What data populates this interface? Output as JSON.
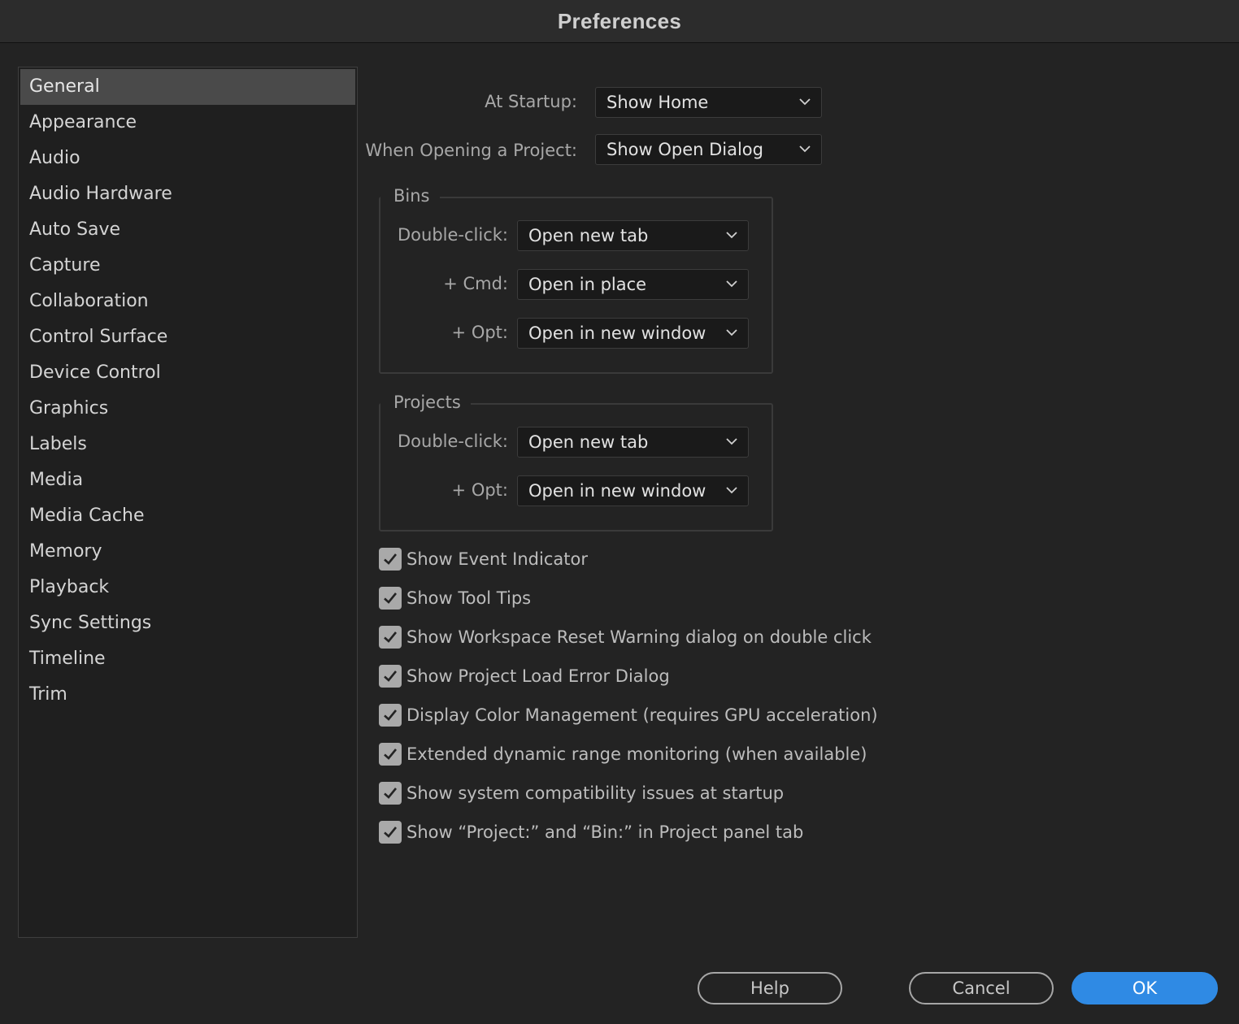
{
  "window": {
    "title": "Preferences"
  },
  "sidebar": {
    "items": [
      {
        "label": "General",
        "selected": true
      },
      {
        "label": "Appearance"
      },
      {
        "label": "Audio"
      },
      {
        "label": "Audio Hardware"
      },
      {
        "label": "Auto Save"
      },
      {
        "label": "Capture"
      },
      {
        "label": "Collaboration"
      },
      {
        "label": "Control Surface"
      },
      {
        "label": "Device Control"
      },
      {
        "label": "Graphics"
      },
      {
        "label": "Labels"
      },
      {
        "label": "Media"
      },
      {
        "label": "Media Cache"
      },
      {
        "label": "Memory"
      },
      {
        "label": "Playback"
      },
      {
        "label": "Sync Settings"
      },
      {
        "label": "Timeline"
      },
      {
        "label": "Trim"
      }
    ]
  },
  "general": {
    "startup": {
      "label": "At Startup:",
      "value": "Show Home"
    },
    "opening_project": {
      "label": "When Opening a Project:",
      "value": "Show Open Dialog"
    },
    "bins": {
      "title": "Bins",
      "double_click": {
        "label": "Double-click:",
        "value": "Open new tab"
      },
      "cmd": {
        "label": "+ Cmd:",
        "value": "Open in place"
      },
      "opt": {
        "label": "+ Opt:",
        "value": "Open in new window"
      }
    },
    "projects": {
      "title": "Projects",
      "double_click": {
        "label": "Double-click:",
        "value": "Open new tab"
      },
      "opt": {
        "label": "+ Opt:",
        "value": "Open in new window"
      }
    },
    "checkboxes": [
      {
        "label": "Show Event Indicator",
        "checked": true
      },
      {
        "label": "Show Tool Tips",
        "checked": true
      },
      {
        "label": "Show Workspace Reset Warning dialog on double click",
        "checked": true
      },
      {
        "label": "Show Project Load Error Dialog",
        "checked": true
      },
      {
        "label": "Display Color Management (requires GPU acceleration)",
        "checked": true
      },
      {
        "label": "Extended dynamic range monitoring (when available)",
        "checked": true
      },
      {
        "label": "Show system compatibility issues at startup",
        "checked": true
      },
      {
        "label": "Show “Project:” and “Bin:” in Project panel tab",
        "checked": true
      }
    ]
  },
  "footer": {
    "help": "Help",
    "cancel": "Cancel",
    "ok": "OK"
  },
  "colors": {
    "accent": "#2f8ae4",
    "background": "#232323",
    "selected": "#4a4a4a"
  }
}
